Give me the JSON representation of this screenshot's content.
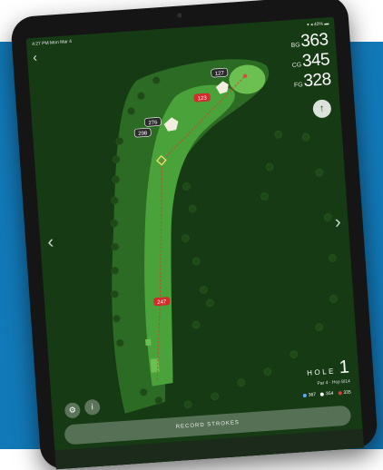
{
  "statusbar": {
    "time": "4:27 PM  Mon Mar 4",
    "battery": "▾ ◂ 40% ▬"
  },
  "yardage": {
    "back": {
      "label": "BG",
      "value": "363"
    },
    "center": {
      "label": "CG",
      "value": "345"
    },
    "front": {
      "label": "FG",
      "value": "328"
    }
  },
  "map": {
    "labels": {
      "green": "127",
      "mid": "123",
      "hazard": "276",
      "hazard_far": "298",
      "tee": "247"
    }
  },
  "hole": {
    "label": "HOLE",
    "number": "1",
    "sub": "Par 4 · Hcp 8/14",
    "tees": [
      {
        "value": "367",
        "color": "#5fa8ff"
      },
      {
        "value": "354",
        "color": "#ffffff"
      },
      {
        "value": "335",
        "color": "#e53935"
      }
    ]
  },
  "controls": {
    "back_icon": "‹",
    "prev_icon": "‹",
    "next_icon": "›",
    "up_icon": "↑",
    "settings_icon": "⚙",
    "info_icon": "i",
    "record_label": "RECORD STROKES"
  }
}
